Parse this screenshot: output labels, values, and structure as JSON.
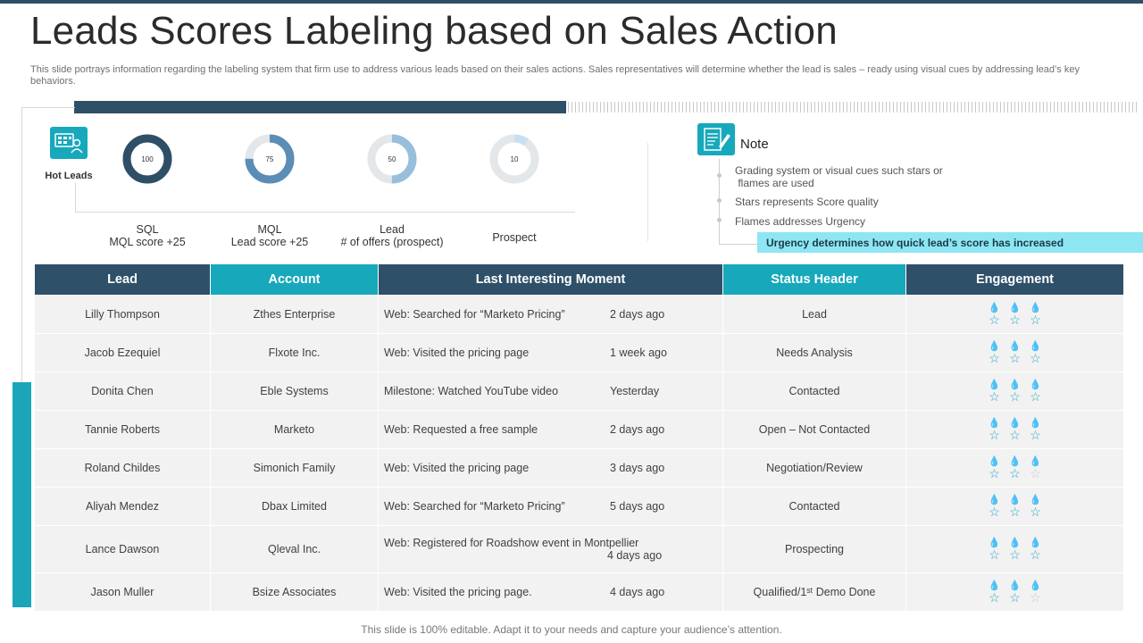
{
  "slide": {
    "title": "Leads Scores Labeling based on Sales Action",
    "description": "This slide portrays information regarding the labeling system that firm use to address various leads based on their sales actions. Sales representatives will determine whether the lead is sales – ready using visual cues by addressing lead’s key behaviors.",
    "footer": "This slide is 100% editable. Adapt it to your needs and capture your audience’s attention."
  },
  "hot_leads": {
    "label": "Hot Leads",
    "icon": "hot-leads-icon"
  },
  "colors": {
    "dark": "#2f5069",
    "teal": "#17a8bb",
    "light_ring": "#e3e7ea",
    "highlight": "#8ee6f2",
    "flame_filled": "#6d86a0",
    "star_filled": "#2aa6c0"
  },
  "scores": [
    {
      "value": "100",
      "percent": 100,
      "color": "#2f4f66",
      "line1": "SQL",
      "line2": "MQL score +25"
    },
    {
      "value": "75",
      "percent": 75,
      "color": "#5b8db5",
      "line1": "MQL",
      "line2": "Lead score +25"
    },
    {
      "value": "50",
      "percent": 50,
      "color": "#97bfdb",
      "line1": "Lead",
      "line2": "# of offers (prospect)"
    },
    {
      "value": "10",
      "percent": 10,
      "color": "#c9dff0",
      "line1": "Prospect",
      "line2": ""
    }
  ],
  "note": {
    "title": "Note",
    "icon": "note-icon",
    "items": [
      "Grading system or visual cues such stars or\n flames are used",
      "Stars represents Score quality",
      "Flames addresses Urgency"
    ],
    "highlight": "Urgency determines how quick lead’s score has increased"
  },
  "table": {
    "headers": [
      "Lead",
      "Account",
      "Last Interesting Moment",
      "Status Header",
      "Engagement"
    ],
    "rows": [
      {
        "lead": "Lilly Thompson",
        "account": "Zthes Enterprise",
        "moment": "Web: Searched for “Marketo Pricing”",
        "time": "2 days ago",
        "status": "Lead",
        "flames": 3,
        "stars": 3
      },
      {
        "lead": "Jacob Ezequiel",
        "account": "Flxote Inc.",
        "moment": "Web: Visited the pricing page",
        "time": "1 week ago",
        "status": "Needs Analysis",
        "flames": 3,
        "stars": 3
      },
      {
        "lead": "Donita Chen",
        "account": "Eble Systems",
        "moment": "Milestone: Watched YouTube video",
        "time": "Yesterday",
        "status": "Contacted",
        "flames": 3,
        "stars": 3
      },
      {
        "lead": "Tannie Roberts",
        "account": "Marketo",
        "moment": "Web: Requested a free sample",
        "time": "2 days ago",
        "status": "Open – Not Contacted",
        "flames": 3,
        "stars": 3
      },
      {
        "lead": "Roland Childes",
        "account": "Simonich Family",
        "moment": "Web: Visited the pricing page",
        "time": "3 days ago",
        "status": "Negotiation/Review",
        "flames": 3,
        "stars": 2
      },
      {
        "lead": "Aliyah Mendez",
        "account": "Dbax Limited",
        "moment": "Web: Searched for “Marketo Pricing”",
        "time": "5 days ago",
        "status": "Contacted",
        "flames": 2,
        "stars": 3
      },
      {
        "lead": "Lance Dawson",
        "account": "Qleval Inc.",
        "moment": "Web: Registered for Roadshow event in Montpellier",
        "time": "4 days ago",
        "status": "Prospecting",
        "flames": 2,
        "stars": 3
      },
      {
        "lead": "Jason Muller",
        "account": "Bsize Associates",
        "moment": "Web: Visited the pricing page.",
        "time": "4 days ago",
        "status": "Qualified/1ˢᵗ Demo Done",
        "flames": 2,
        "stars": 2
      }
    ]
  }
}
